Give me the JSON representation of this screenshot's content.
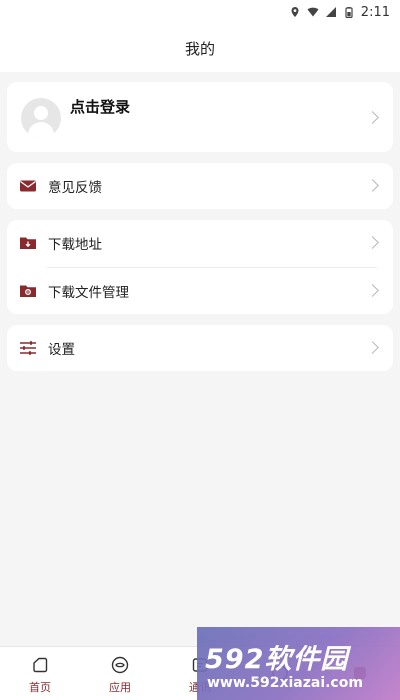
{
  "status_bar": {
    "time": "2:11",
    "icons": [
      "location-icon",
      "wifi-icon",
      "signal-icon",
      "battery-icon"
    ]
  },
  "header": {
    "title": "我的"
  },
  "profile": {
    "login_label": "点击登录"
  },
  "menu": {
    "feedback": {
      "label": "意见反馈",
      "icon": "envelope-icon"
    },
    "download_address": {
      "label": "下载地址",
      "icon": "folder-download-icon"
    },
    "download_manage": {
      "label": "下载文件管理",
      "icon": "folder-manage-icon"
    },
    "settings": {
      "label": "设置",
      "icon": "sliders-icon"
    }
  },
  "tabs": [
    {
      "label": "首页",
      "icon": "home-icon"
    },
    {
      "label": "应用",
      "icon": "app-icon"
    },
    {
      "label": "通讯",
      "icon": "chat-icon"
    },
    {
      "label": "",
      "icon": "explore-icon"
    },
    {
      "label": "",
      "icon": "profile-icon"
    }
  ],
  "watermark": {
    "brand": "592软件园",
    "url": "www.592xiazai.com"
  },
  "colors": {
    "accent": "#8b2a2e",
    "background": "#f5f5f6",
    "card": "#ffffff"
  }
}
